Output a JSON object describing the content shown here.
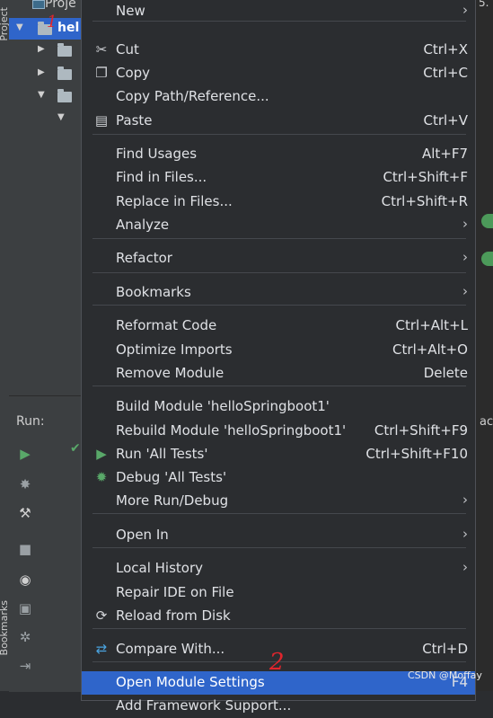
{
  "project": {
    "panel_title": "Proje",
    "vertical_label": "Project",
    "vertical_label_bottom": "Bookmarks",
    "selected_node": "hel"
  },
  "run": {
    "label": "Run:"
  },
  "right_edge": {
    "top_text": "5.",
    "run_text": "ac"
  },
  "menu": {
    "items": [
      {
        "label": "New",
        "shortcut": "",
        "submenu": true,
        "icon": ""
      },
      {
        "label": "Cut",
        "shortcut": "Ctrl+X",
        "submenu": false,
        "icon": "scissors-icon"
      },
      {
        "label": "Copy",
        "shortcut": "Ctrl+C",
        "submenu": false,
        "icon": "copy-icon"
      },
      {
        "label": "Copy Path/Reference...",
        "shortcut": "",
        "submenu": false,
        "icon": ""
      },
      {
        "label": "Paste",
        "shortcut": "Ctrl+V",
        "submenu": false,
        "icon": "paste-icon"
      },
      {
        "label": "Find Usages",
        "shortcut": "Alt+F7",
        "submenu": false,
        "icon": ""
      },
      {
        "label": "Find in Files...",
        "shortcut": "Ctrl+Shift+F",
        "submenu": false,
        "icon": ""
      },
      {
        "label": "Replace in Files...",
        "shortcut": "Ctrl+Shift+R",
        "submenu": false,
        "icon": ""
      },
      {
        "label": "Analyze",
        "shortcut": "",
        "submenu": true,
        "icon": ""
      },
      {
        "label": "Refactor",
        "shortcut": "",
        "submenu": true,
        "icon": ""
      },
      {
        "label": "Bookmarks",
        "shortcut": "",
        "submenu": true,
        "icon": ""
      },
      {
        "label": "Reformat Code",
        "shortcut": "Ctrl+Alt+L",
        "submenu": false,
        "icon": ""
      },
      {
        "label": "Optimize Imports",
        "shortcut": "Ctrl+Alt+O",
        "submenu": false,
        "icon": ""
      },
      {
        "label": "Remove Module",
        "shortcut": "Delete",
        "submenu": false,
        "icon": ""
      },
      {
        "label": "Build Module 'helloSpringboot1'",
        "shortcut": "",
        "submenu": false,
        "icon": ""
      },
      {
        "label": "Rebuild Module 'helloSpringboot1'",
        "shortcut": "Ctrl+Shift+F9",
        "submenu": false,
        "icon": ""
      },
      {
        "label": "Run 'All Tests'",
        "shortcut": "Ctrl+Shift+F10",
        "submenu": false,
        "icon": "run-icon"
      },
      {
        "label": "Debug 'All Tests'",
        "shortcut": "",
        "submenu": false,
        "icon": "debug-icon"
      },
      {
        "label": "More Run/Debug",
        "shortcut": "",
        "submenu": true,
        "icon": ""
      },
      {
        "label": "Open In",
        "shortcut": "",
        "submenu": true,
        "icon": ""
      },
      {
        "label": "Local History",
        "shortcut": "",
        "submenu": true,
        "icon": ""
      },
      {
        "label": "Repair IDE on File",
        "shortcut": "",
        "submenu": false,
        "icon": ""
      },
      {
        "label": "Reload from Disk",
        "shortcut": "",
        "submenu": false,
        "icon": "reload-icon"
      },
      {
        "label": "Compare With...",
        "shortcut": "Ctrl+D",
        "submenu": false,
        "icon": "compare-icon"
      },
      {
        "label": "Open Module Settings",
        "shortcut": "F4",
        "submenu": false,
        "icon": "",
        "highlighted": true
      },
      {
        "label": "Add Framework Support...",
        "shortcut": "",
        "submenu": false,
        "icon": ""
      }
    ]
  },
  "annotations": {
    "mark_1": "1",
    "mark_2": "2"
  },
  "watermark": "CSDN @Moffay",
  "colors": {
    "highlight": "#2f65ca",
    "menu_bg": "#2b2d30",
    "annotation": "#e0252d",
    "run_green": "#59a869"
  }
}
